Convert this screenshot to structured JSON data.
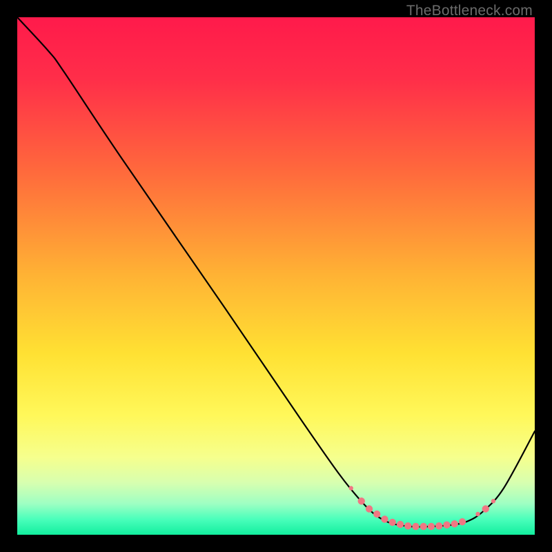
{
  "attribution": "TheBottleneck.com",
  "chart_data": {
    "type": "line",
    "title": "",
    "xlabel": "",
    "ylabel": "",
    "xlim": [
      0,
      100
    ],
    "ylim": [
      0,
      100
    ],
    "gradient_stops": [
      {
        "offset": 0.0,
        "color": "#ff1a4b"
      },
      {
        "offset": 0.12,
        "color": "#ff2e49"
      },
      {
        "offset": 0.3,
        "color": "#ff6a3c"
      },
      {
        "offset": 0.5,
        "color": "#ffb334"
      },
      {
        "offset": 0.65,
        "color": "#ffe133"
      },
      {
        "offset": 0.77,
        "color": "#fff85a"
      },
      {
        "offset": 0.85,
        "color": "#f6ff8d"
      },
      {
        "offset": 0.9,
        "color": "#d7ffb0"
      },
      {
        "offset": 0.94,
        "color": "#9effc3"
      },
      {
        "offset": 0.97,
        "color": "#4affbb"
      },
      {
        "offset": 1.0,
        "color": "#12ee9e"
      }
    ],
    "series": [
      {
        "name": "bottleneck-curve",
        "color": "#000000",
        "points": [
          {
            "x": 0.0,
            "y": 100.0
          },
          {
            "x": 6.0,
            "y": 93.5
          },
          {
            "x": 9.0,
            "y": 89.5
          },
          {
            "x": 20.0,
            "y": 73.0
          },
          {
            "x": 40.0,
            "y": 44.0
          },
          {
            "x": 55.0,
            "y": 22.0
          },
          {
            "x": 62.0,
            "y": 12.0
          },
          {
            "x": 66.0,
            "y": 7.0
          },
          {
            "x": 69.0,
            "y": 4.0
          },
          {
            "x": 72.0,
            "y": 2.3
          },
          {
            "x": 76.0,
            "y": 1.6
          },
          {
            "x": 80.0,
            "y": 1.6
          },
          {
            "x": 84.0,
            "y": 1.9
          },
          {
            "x": 87.0,
            "y": 2.6
          },
          {
            "x": 90.0,
            "y": 4.5
          },
          {
            "x": 94.0,
            "y": 9.0
          },
          {
            "x": 100.0,
            "y": 20.0
          }
        ]
      }
    ],
    "markers": {
      "color": "#f07783",
      "radius_small": 3.2,
      "radius_large": 5.2,
      "points": [
        {
          "x": 64.5,
          "y": 9.0,
          "r": "small"
        },
        {
          "x": 66.5,
          "y": 6.5,
          "r": "large"
        },
        {
          "x": 68.0,
          "y": 5.0,
          "r": "large"
        },
        {
          "x": 69.5,
          "y": 4.0,
          "r": "large"
        },
        {
          "x": 71.0,
          "y": 3.0,
          "r": "large"
        },
        {
          "x": 72.5,
          "y": 2.4,
          "r": "large"
        },
        {
          "x": 74.0,
          "y": 2.0,
          "r": "large"
        },
        {
          "x": 75.5,
          "y": 1.7,
          "r": "large"
        },
        {
          "x": 77.0,
          "y": 1.6,
          "r": "large"
        },
        {
          "x": 78.5,
          "y": 1.6,
          "r": "large"
        },
        {
          "x": 80.0,
          "y": 1.6,
          "r": "large"
        },
        {
          "x": 81.5,
          "y": 1.7,
          "r": "large"
        },
        {
          "x": 83.0,
          "y": 1.9,
          "r": "large"
        },
        {
          "x": 84.5,
          "y": 2.1,
          "r": "large"
        },
        {
          "x": 86.0,
          "y": 2.5,
          "r": "large"
        },
        {
          "x": 89.0,
          "y": 4.0,
          "r": "small"
        },
        {
          "x": 90.5,
          "y": 5.0,
          "r": "large"
        },
        {
          "x": 92.0,
          "y": 6.5,
          "r": "small"
        }
      ]
    }
  }
}
